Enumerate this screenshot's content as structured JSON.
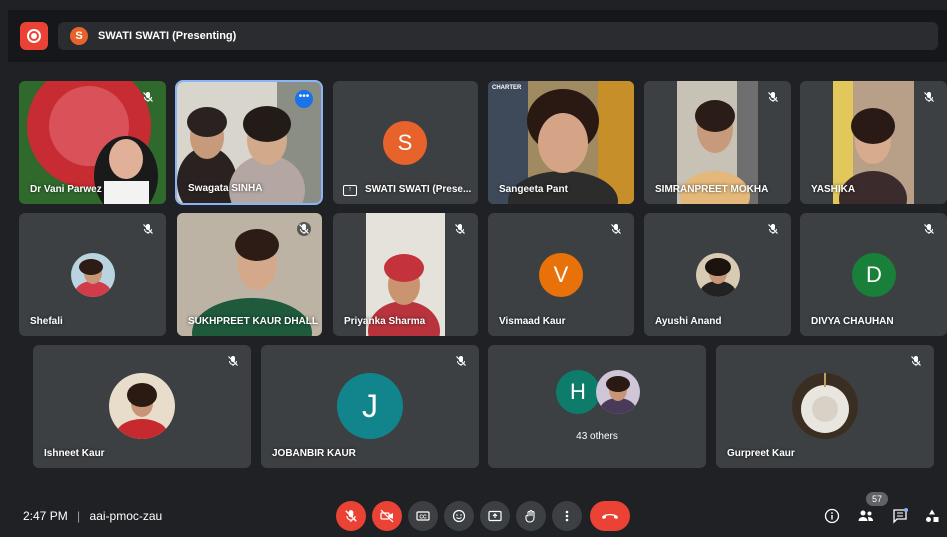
{
  "presenting_bar": {
    "avatar_letter": "S",
    "text": "SWATI SWATI (Presenting)"
  },
  "tiles": {
    "vani": {
      "name": "Dr Vani Parwez"
    },
    "swagata": {
      "name": "Swagata SINHA"
    },
    "swati": {
      "name": "SWATI SWATI (Prese...",
      "letter": "S",
      "color": "#e8632b"
    },
    "sangeeta": {
      "name": "Sangeeta Pant",
      "poster_text": "CHARTER"
    },
    "simranpreet": {
      "name": "SIMRANPREET MOKHA"
    },
    "yashika": {
      "name": "YASHIKA"
    },
    "shefali": {
      "name": "Shefali"
    },
    "sukhpreet": {
      "name": "SUKHPREET KAUR DHALL"
    },
    "priyanka": {
      "name": "Priyanka Sharma"
    },
    "vismaad": {
      "name": "Vismaad Kaur",
      "letter": "V",
      "color": "#e8710a"
    },
    "ayushi": {
      "name": "Ayushi Anand"
    },
    "divya": {
      "name": "DIVYA CHAUHAN",
      "letter": "D",
      "color": "#188038"
    },
    "ishneet": {
      "name": "Ishneet Kaur"
    },
    "jobanbir": {
      "name": "JOBANBIR KAUR",
      "letter": "J",
      "color": "#12858c"
    },
    "others": {
      "label": "43 others",
      "letter": "H",
      "color": "#0e7c6b"
    },
    "gurpreet": {
      "name": "Gurpreet Kaur"
    }
  },
  "bottom": {
    "time": "2:47 PM",
    "separator": "|",
    "meeting_code": "aai-pmoc-zau",
    "participants_badge": "57"
  },
  "icons": {
    "mute": "mic-off-icon",
    "more": "more-options-icon"
  }
}
